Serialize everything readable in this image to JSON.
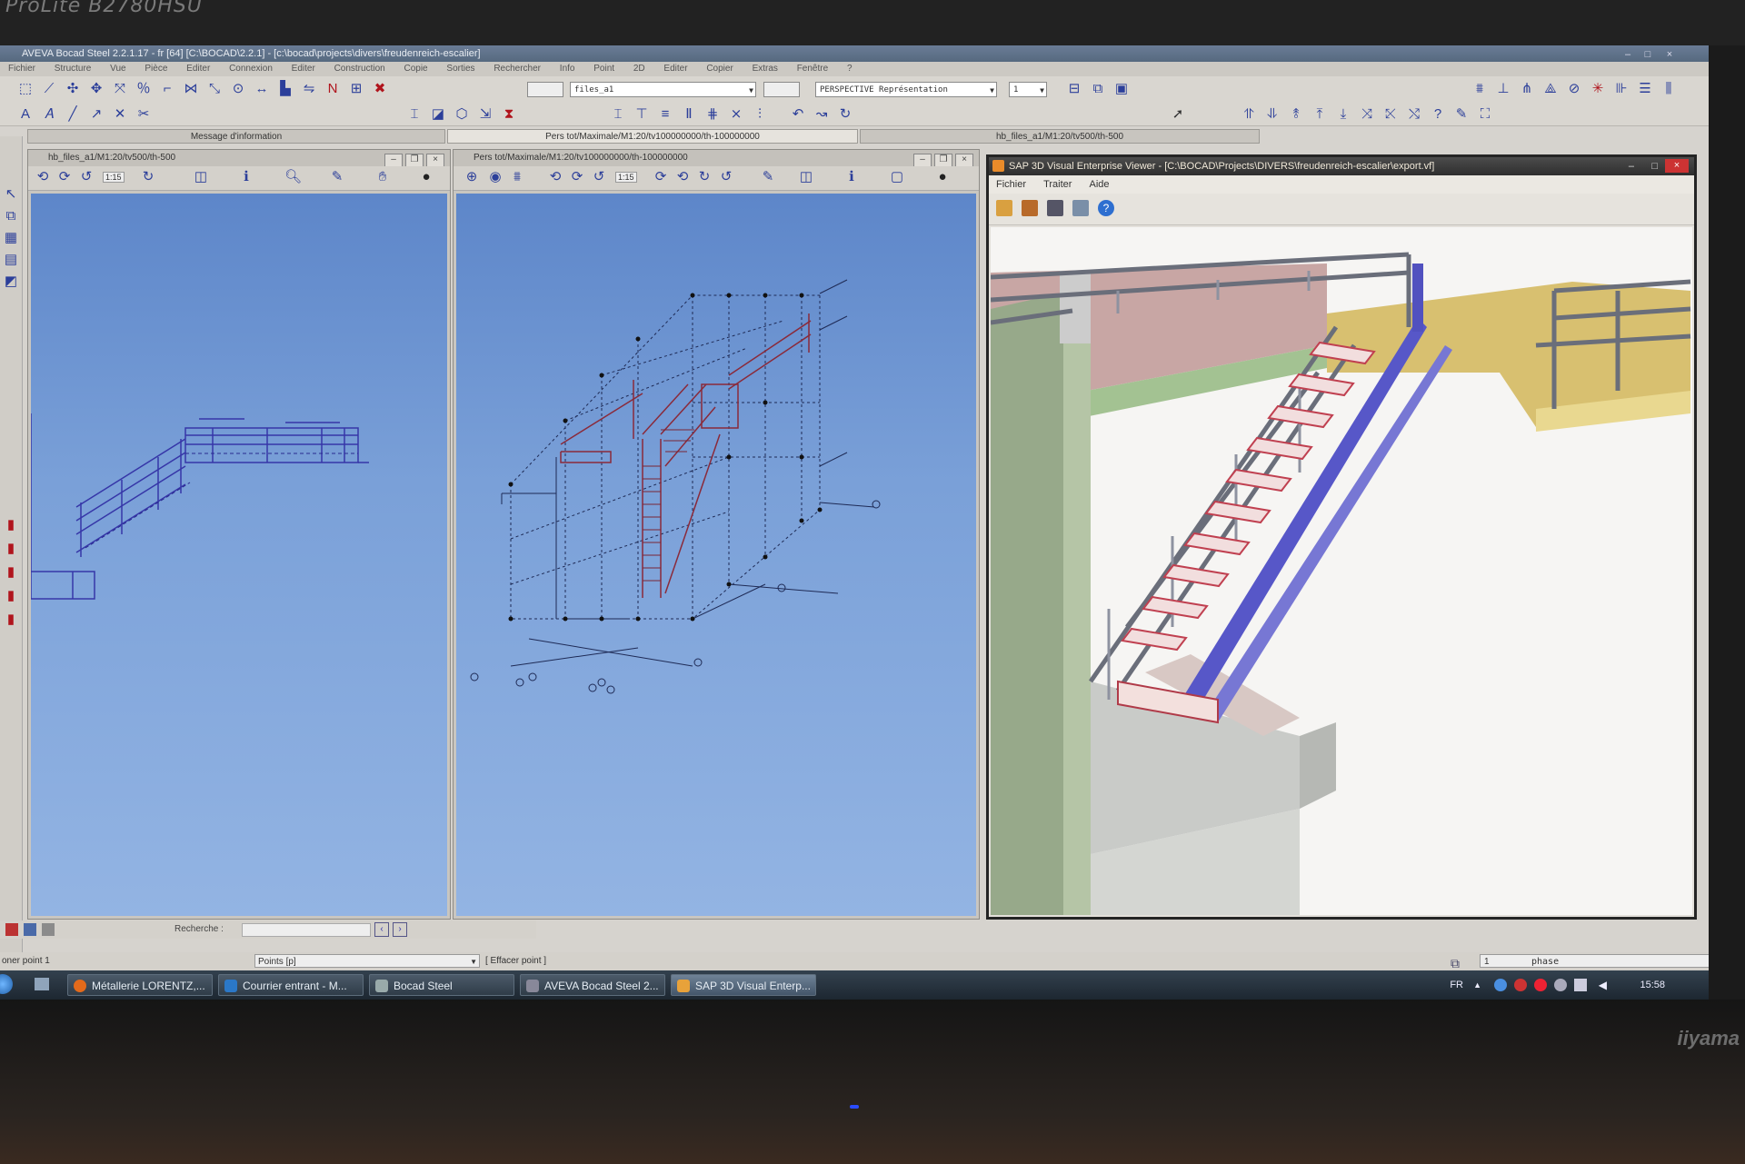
{
  "monitor": {
    "brand_top": "ProLite B2780HSU",
    "brand_bottom": "iiyama"
  },
  "app": {
    "title": "AVEVA Bocad Steel 2.2.1.17 - fr [64]  [C:\\BOCAD\\2.2.1]  -  [c:\\bocad\\projects\\divers\\freudenreich-escalier]",
    "menu": [
      "Fichier",
      "Structure",
      "Vue",
      "Pièce",
      "Editer",
      "Connexion",
      "Editer",
      "Construction",
      "Copie",
      "Sorties",
      "Rechercher",
      "Info",
      "Point",
      "2D",
      "Editer",
      "Copier",
      "Extras",
      "Fenêtre",
      "?"
    ],
    "combo_files": "files_a1",
    "combo_view": "PERSPECTIVE  Représentation",
    "combo_small": "1"
  },
  "tabs": {
    "message": "Message d'information",
    "pers": "Pers tot/Maximale/M1:20/tv100000000/th-100000000",
    "files": "hb_files_a1/M1:20/tv500/th-500"
  },
  "windows": {
    "left_title": "hb_files_a1/M1:20/tv500/th-500",
    "middle_title": "Pers tot/Maximale/M1:20/tv100000000/th-100000000",
    "scale": "1:15"
  },
  "sap": {
    "title": "SAP 3D Visual Enterprise Viewer - [C:\\BOCAD\\Projects\\DIVERS\\freudenreich-escalier\\export.vf]",
    "menu": [
      "Fichier",
      "Traiter",
      "Aide"
    ]
  },
  "bottom": {
    "search_label": "Recherche :",
    "status_left": "oner point 1",
    "points_combo": "Points [p]",
    "effacer": "[ Effacer point ]",
    "phase_num": "1",
    "phase_label": "phase"
  },
  "taskbar": {
    "items": [
      "Métallerie LORENTZ,...",
      "Courrier entrant - M...",
      "Bocad Steel",
      "AVEVA Bocad Steel 2...",
      "SAP 3D Visual Enterp..."
    ],
    "lang": "FR",
    "clock": "15:58"
  },
  "colors": {
    "viewport_blue": "#7aa0d8",
    "stair_blue": "#5757c8",
    "tread_red": "#c04050",
    "landing_yellow": "#e0c86a"
  }
}
